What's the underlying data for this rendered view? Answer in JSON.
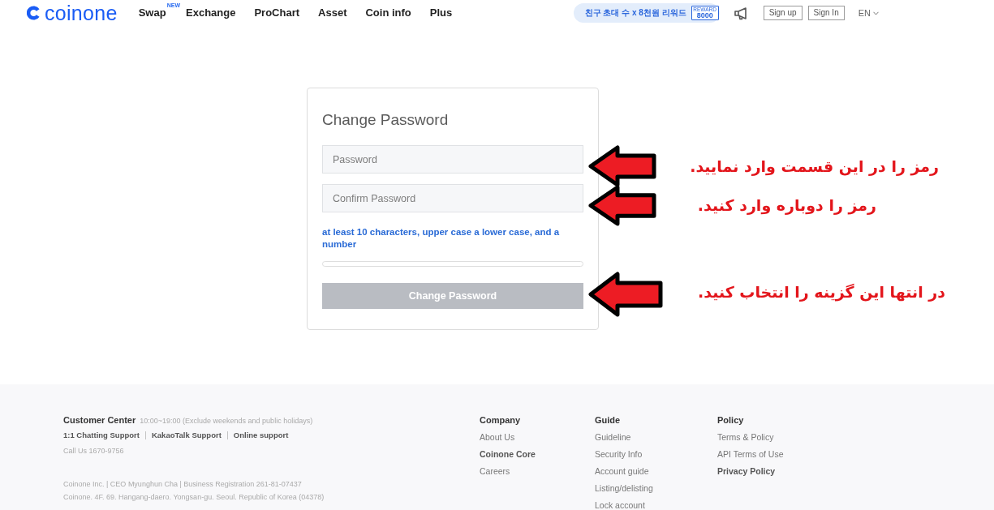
{
  "header": {
    "logo": "coinone",
    "nav": [
      {
        "label": "Swap",
        "badge": "NEW"
      },
      {
        "label": "Exchange"
      },
      {
        "label": "ProChart"
      },
      {
        "label": "Asset"
      },
      {
        "label": "Coin info"
      },
      {
        "label": "Plus"
      }
    ],
    "promo": {
      "text": "친구 초대 수 x 8천원 리워드",
      "tag_caption": "REWARD",
      "tag_value": "8000"
    },
    "buttons": [
      "Sign up",
      "Sign In"
    ],
    "language": "EN"
  },
  "change_password": {
    "title": "Change Password",
    "fields": [
      {
        "placeholder": "Password"
      },
      {
        "placeholder": "Confirm Password"
      }
    ],
    "hint": "at least 10 characters, upper case a lower case, and a number",
    "submit": {
      "label": "Change Password",
      "disabled": true
    }
  },
  "annotations": [
    {
      "text": "رمز را در این قسمت وارد نمایید."
    },
    {
      "text": "رمز را دوباره وارد کنید."
    },
    {
      "text": "در انتها این گزینه را انتخاب کنید."
    }
  ],
  "footer": {
    "customer_center": {
      "title": "Customer Center",
      "hours": "10:00~19:00 (Exclude weekends and public holidays)",
      "links": [
        "1:1 Chatting Support",
        "KakaoTalk Support",
        "Online support"
      ],
      "phone": "Call Us 1670-9756"
    },
    "company_info": [
      "Coinone Inc. | CEO Myunghun Cha | Business Registration 261-81-07437",
      "Coinone. 4F. 69. Hangang-daero. Yongsan-gu. Seoul. Republic of Korea (04378)"
    ],
    "columns": [
      {
        "title": "Company",
        "links": [
          {
            "label": "About Us",
            "emphasized": false
          },
          {
            "label": "Coinone Core",
            "emphasized": true
          },
          {
            "label": "Careers",
            "emphasized": false
          }
        ]
      },
      {
        "title": "Guide",
        "links": [
          {
            "label": "Guideline",
            "emphasized": false
          },
          {
            "label": "Security Info",
            "emphasized": false
          },
          {
            "label": "Account guide",
            "emphasized": false
          },
          {
            "label": "Listing/delisting",
            "emphasized": false
          },
          {
            "label": "Lock account",
            "emphasized": false
          }
        ]
      },
      {
        "title": "Policy",
        "links": [
          {
            "label": "Terms & Policy",
            "emphasized": false
          },
          {
            "label": "API Terms of Use",
            "emphasized": false
          },
          {
            "label": "Privacy Policy",
            "emphasized": true
          }
        ]
      }
    ]
  }
}
